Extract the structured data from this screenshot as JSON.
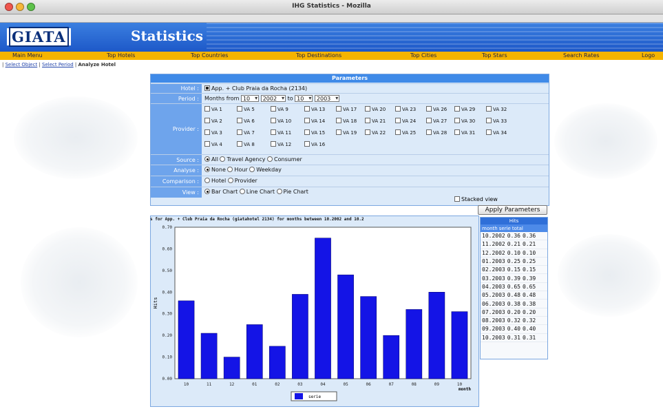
{
  "window": {
    "title": "IHG Statistics - Mozilla"
  },
  "header": {
    "logo": "GIATA",
    "title": "Statistics"
  },
  "menu": [
    "Main Menu",
    "Top Hotels",
    "Top Countries",
    "Top Destinations",
    "Top Cities",
    "Top Stars",
    "Search Rates",
    "Logo"
  ],
  "breadcrumb": {
    "items": [
      "Select Object",
      "Select Period"
    ],
    "current": "Analyze Hotel"
  },
  "parameters": {
    "title": "Parameters",
    "hotel_label": "Hotel :",
    "hotel_value": "App. + Club Praia da Rocha (2134)",
    "period_label": "Period :",
    "period_text": "Months from",
    "from_month": "10",
    "from_year": "2002",
    "to_text": "to",
    "to_month": "10",
    "to_year": "2003",
    "provider_label": "Provider :",
    "providers": [
      "VA 1",
      "VA 5",
      "VA 9",
      "VA 13",
      "VA 17",
      "VA 20",
      "VA 23",
      "VA 26",
      "VA 29",
      "VA 32",
      "VA 2",
      "VA 6",
      "VA 10",
      "VA 14",
      "VA 18",
      "VA 21",
      "VA 24",
      "VA 27",
      "VA 30",
      "VA 33",
      "VA 3",
      "VA 7",
      "VA 11",
      "VA 15",
      "VA 19",
      "VA 22",
      "VA 25",
      "VA 28",
      "VA 31",
      "VA 34",
      "VA 4",
      "VA 8",
      "VA 12",
      "VA 16"
    ],
    "source_label": "Source :",
    "source_options": [
      "All",
      "Travel Agency",
      "Consumer"
    ],
    "analyse_label": "Analyse :",
    "analyse_options": [
      "None",
      "Hour",
      "Weekday"
    ],
    "comparison_label": "Comparison :",
    "comparison_options": [
      "Hotel",
      "Provider"
    ],
    "view_label": "View :",
    "view_options": [
      "Bar Chart",
      "Line Chart",
      "Pie Chart"
    ],
    "stacked_label": "Stacked view",
    "apply_label": "Apply Parameters"
  },
  "chart_data": {
    "type": "bar",
    "title": "s for App. + Club Praia da Rocha (giatahotel 2134) for months between 10.2002 and 10.2",
    "xlabel": "month",
    "ylabel": "Hits",
    "categories": [
      "10",
      "11",
      "12",
      "01",
      "02",
      "03",
      "04",
      "05",
      "06",
      "07",
      "08",
      "09",
      "10"
    ],
    "values": [
      0.36,
      0.21,
      0.1,
      0.25,
      0.15,
      0.39,
      0.65,
      0.48,
      0.38,
      0.2,
      0.32,
      0.4,
      0.31
    ],
    "ylim": [
      0,
      0.7
    ],
    "yticks": [
      "0.00",
      "0.10",
      "0.20",
      "0.30",
      "0.40",
      "0.50",
      "0.60",
      "0.70"
    ],
    "legend": "serie",
    "bar_color": "#1414e6"
  },
  "table": {
    "title": "Hits",
    "columns": [
      "month",
      "serie",
      "total"
    ],
    "rows": [
      [
        "10.2002",
        "0.36",
        "0.36"
      ],
      [
        "11.2002",
        "0.21",
        "0.21"
      ],
      [
        "12.2002",
        "0.10",
        "0.10"
      ],
      [
        "01.2003",
        "0.25",
        "0.25"
      ],
      [
        "02.2003",
        "0.15",
        "0.15"
      ],
      [
        "03.2003",
        "0.39",
        "0.39"
      ],
      [
        "04.2003",
        "0.65",
        "0.65"
      ],
      [
        "05.2003",
        "0.48",
        "0.48"
      ],
      [
        "06.2003",
        "0.38",
        "0.38"
      ],
      [
        "07.2003",
        "0.20",
        "0.20"
      ],
      [
        "08.2003",
        "0.32",
        "0.32"
      ],
      [
        "09.2003",
        "0.40",
        "0.40"
      ],
      [
        "10.2003",
        "0.31",
        "0.31"
      ]
    ]
  },
  "colors": {
    "banner": "#2b6ad6",
    "menubar": "#f5b400",
    "panel": "#dceaf9",
    "label_bg": "#6ea4ec"
  }
}
